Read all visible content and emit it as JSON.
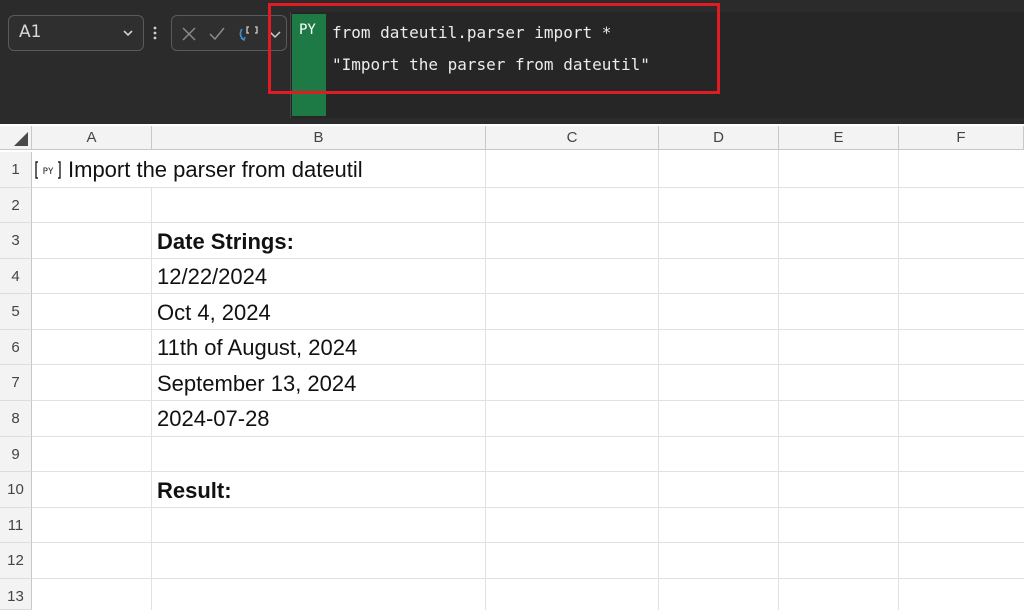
{
  "formula_bar": {
    "name_box": "A1",
    "py_tag": "PY",
    "code_lines": [
      "from dateutil.parser import *",
      "\"Import the parser from dateutil\""
    ]
  },
  "sheet": {
    "columns": [
      "A",
      "B",
      "C",
      "D",
      "E",
      "F"
    ],
    "rows": [
      "1",
      "2",
      "3",
      "4",
      "5",
      "6",
      "7",
      "8",
      "9",
      "10",
      "11",
      "12",
      "13"
    ],
    "cells": {
      "A1": "Import the parser from dateutil",
      "B3": "Date Strings:",
      "B4": "12/22/2024",
      "B5": "Oct 4, 2024",
      "B6": "11th of August, 2024",
      "B7": "September 13, 2024",
      "B8": "2024-07-28",
      "B10": "Result:"
    }
  },
  "colors": {
    "formula_bar_bg": "#2b2b2b",
    "py_tag": "#1e7a45",
    "highlight": "#e01b24"
  },
  "icons": [
    "chevron-down-icon",
    "kebab-icon",
    "cancel-icon",
    "enter-icon",
    "python-insert-icon",
    "python-badge-icon"
  ]
}
